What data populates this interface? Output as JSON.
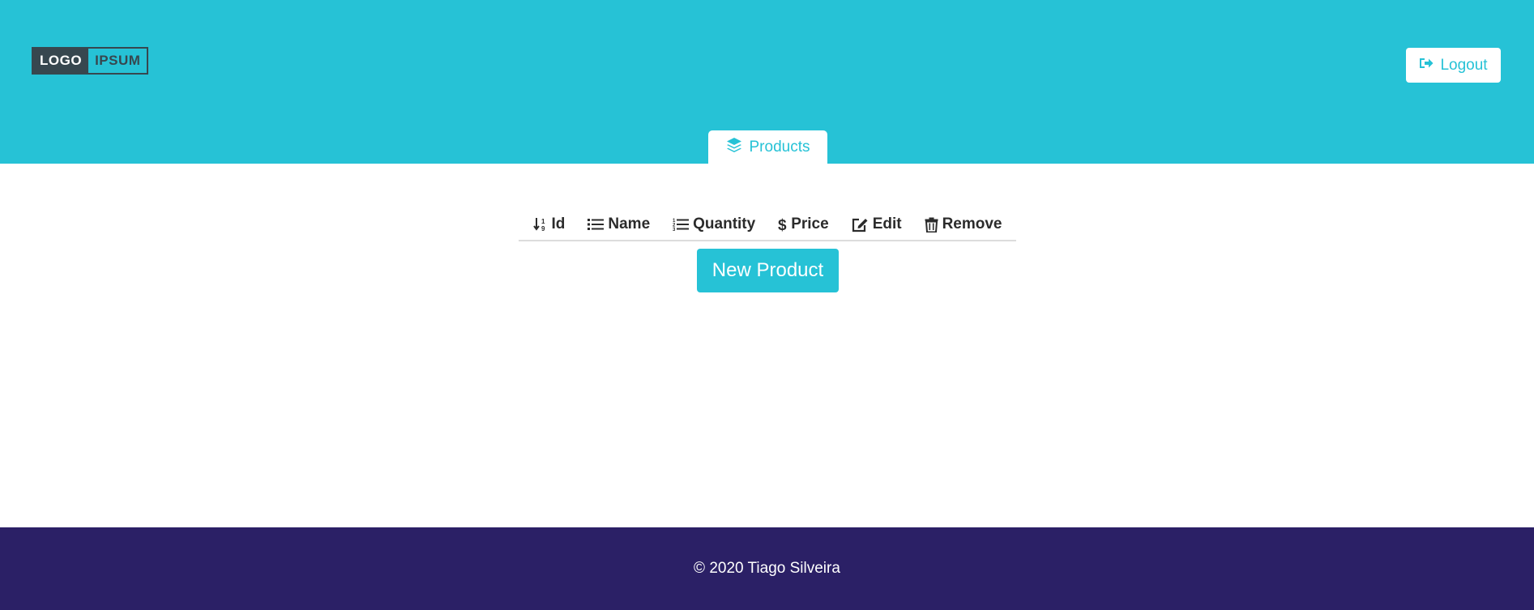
{
  "header": {
    "logo": {
      "part1": "LOGO",
      "part2": "IPSUM"
    },
    "logout_label": "Logout",
    "tab_label": "Products"
  },
  "table": {
    "columns": [
      {
        "label": "Id",
        "icon": "sort-numeric-icon"
      },
      {
        "label": "Name",
        "icon": "list-icon"
      },
      {
        "label": "Quantity",
        "icon": "list-ol-icon"
      },
      {
        "label": "Price",
        "icon": "dollar-icon"
      },
      {
        "label": "Edit",
        "icon": "edit-icon"
      },
      {
        "label": "Remove",
        "icon": "trash-icon"
      }
    ]
  },
  "actions": {
    "new_product_label": "New Product"
  },
  "footer": {
    "copyright": "© 2020 Tiago Silveira"
  },
  "colors": {
    "accent": "#26c2d6",
    "footer_bg": "#2b2066",
    "text_dark": "#2b2b2b",
    "logo_dark": "#37474f"
  }
}
